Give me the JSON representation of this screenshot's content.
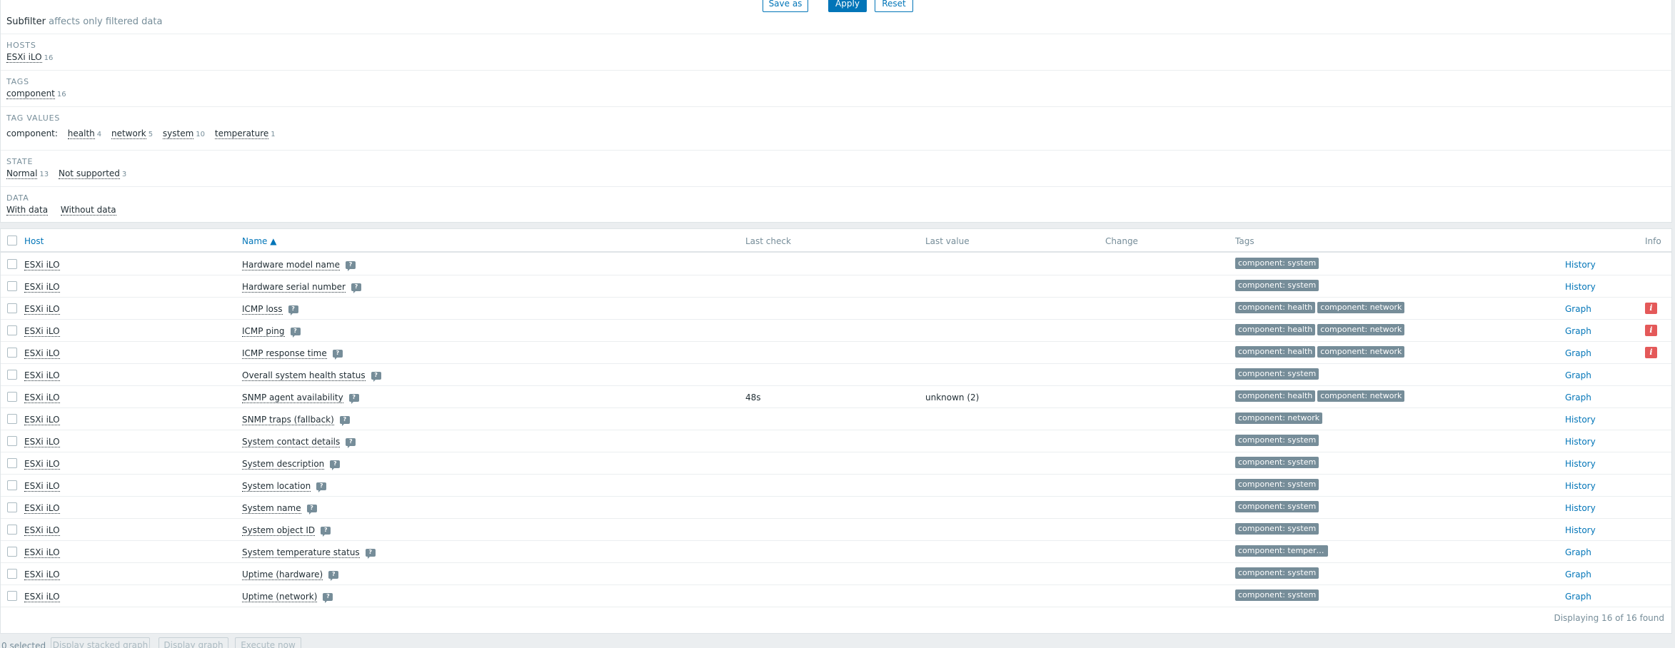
{
  "filter": {
    "save_as": "Save as",
    "apply": "Apply",
    "reset": "Reset"
  },
  "subfilter": {
    "title": "Subfilter",
    "note": "affects only filtered data",
    "hosts": {
      "label": "HOSTS",
      "items": [
        {
          "name": "ESXi iLO",
          "count": "16"
        }
      ]
    },
    "tags": {
      "label": "TAGS",
      "items": [
        {
          "name": "component",
          "count": "16"
        }
      ]
    },
    "tag_values": {
      "label": "TAG VALUES",
      "prefix": "component:",
      "items": [
        {
          "name": "health",
          "count": "4"
        },
        {
          "name": "network",
          "count": "5"
        },
        {
          "name": "system",
          "count": "10"
        },
        {
          "name": "temperature",
          "count": "1"
        }
      ]
    },
    "state": {
      "label": "STATE",
      "items": [
        {
          "name": "Normal",
          "count": "13"
        },
        {
          "name": "Not supported",
          "count": "3"
        }
      ]
    },
    "data": {
      "label": "DATA",
      "items": [
        {
          "name": "With data"
        },
        {
          "name": "Without data"
        }
      ]
    }
  },
  "table": {
    "headers": {
      "host": "Host",
      "name": "Name ▲",
      "last_check": "Last check",
      "last_value": "Last value",
      "change": "Change",
      "tags": "Tags",
      "info": "Info"
    },
    "rows": [
      {
        "host": "ESXi iLO",
        "name": "Hardware model name",
        "last_check": "",
        "last_value": "",
        "tags": [
          "component: system"
        ],
        "action": "History",
        "info": false
      },
      {
        "host": "ESXi iLO",
        "name": "Hardware serial number",
        "last_check": "",
        "last_value": "",
        "tags": [
          "component: system"
        ],
        "action": "History",
        "info": false
      },
      {
        "host": "ESXi iLO",
        "name": "ICMP loss",
        "last_check": "",
        "last_value": "",
        "tags": [
          "component: health",
          "component: network"
        ],
        "action": "Graph",
        "info": true
      },
      {
        "host": "ESXi iLO",
        "name": "ICMP ping",
        "last_check": "",
        "last_value": "",
        "tags": [
          "component: health",
          "component: network"
        ],
        "action": "Graph",
        "info": true
      },
      {
        "host": "ESXi iLO",
        "name": "ICMP response time",
        "last_check": "",
        "last_value": "",
        "tags": [
          "component: health",
          "component: network"
        ],
        "action": "Graph",
        "info": true
      },
      {
        "host": "ESXi iLO",
        "name": "Overall system health status",
        "last_check": "",
        "last_value": "",
        "tags": [
          "component: system"
        ],
        "action": "Graph",
        "info": false
      },
      {
        "host": "ESXi iLO",
        "name": "SNMP agent availability",
        "last_check": "48s",
        "last_value": "unknown (2)",
        "tags": [
          "component: health",
          "component: network"
        ],
        "action": "Graph",
        "info": false
      },
      {
        "host": "ESXi iLO",
        "name": "SNMP traps (fallback)",
        "last_check": "",
        "last_value": "",
        "tags": [
          "component: network"
        ],
        "action": "History",
        "info": false
      },
      {
        "host": "ESXi iLO",
        "name": "System contact details",
        "last_check": "",
        "last_value": "",
        "tags": [
          "component: system"
        ],
        "action": "History",
        "info": false
      },
      {
        "host": "ESXi iLO",
        "name": "System description",
        "last_check": "",
        "last_value": "",
        "tags": [
          "component: system"
        ],
        "action": "History",
        "info": false
      },
      {
        "host": "ESXi iLO",
        "name": "System location",
        "last_check": "",
        "last_value": "",
        "tags": [
          "component: system"
        ],
        "action": "History",
        "info": false
      },
      {
        "host": "ESXi iLO",
        "name": "System name",
        "last_check": "",
        "last_value": "",
        "tags": [
          "component: system"
        ],
        "action": "History",
        "info": false
      },
      {
        "host": "ESXi iLO",
        "name": "System object ID",
        "last_check": "",
        "last_value": "",
        "tags": [
          "component: system"
        ],
        "action": "History",
        "info": false
      },
      {
        "host": "ESXi iLO",
        "name": "System temperature status",
        "last_check": "",
        "last_value": "",
        "tags": [
          "component: temperat..."
        ],
        "action": "Graph",
        "info": false
      },
      {
        "host": "ESXi iLO",
        "name": "Uptime (hardware)",
        "last_check": "",
        "last_value": "",
        "tags": [
          "component: system"
        ],
        "action": "Graph",
        "info": false
      },
      {
        "host": "ESXi iLO",
        "name": "Uptime (network)",
        "last_check": "",
        "last_value": "",
        "tags": [
          "component: system"
        ],
        "action": "Graph",
        "info": false
      }
    ],
    "footer": "Displaying 16 of 16 found",
    "info_glyph": "i"
  },
  "bottom": {
    "selected": "0 selected",
    "buttons": [
      "Display stacked graph",
      "Display graph",
      "Execute now"
    ]
  },
  "colors": {
    "accent": "#0275b8",
    "tag": "#768d99",
    "info": "#e45959"
  }
}
